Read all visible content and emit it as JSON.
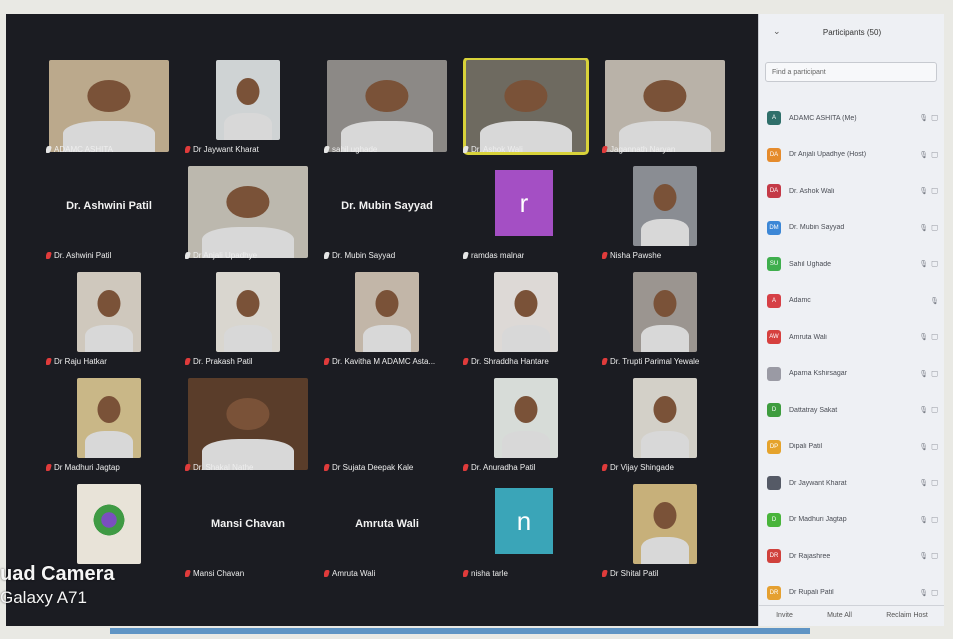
{
  "participants_panel": {
    "title": "Participants (50)",
    "search_placeholder": "Find a participant",
    "footer": [
      "Invite",
      "Mute All",
      "Reclaim Host"
    ],
    "rows": [
      {
        "initials": "A",
        "name": "ADAMC ASHITA (Me)",
        "color": "#2f6f6a",
        "status": "🎙 ◻"
      },
      {
        "initials": "DA",
        "name": "Dr Anjali Upadhye (Host)",
        "color": "#e58b2c",
        "status": "🎙 ◻"
      },
      {
        "initials": "DA",
        "name": "Dr. Ashok Wali",
        "color": "#c43a47",
        "status": "🎙 ◻"
      },
      {
        "initials": "DM",
        "name": "Dr. Mubin Sayyad",
        "color": "#3c87d6",
        "status": "🎙 ◻"
      },
      {
        "initials": "SU",
        "name": "Sahil Ughade",
        "color": "#3fae4d",
        "status": "🎙 ◻"
      },
      {
        "initials": "A",
        "name": "Adamc",
        "color": "#d64046",
        "status": "🎙"
      },
      {
        "initials": "AW",
        "name": "Amruta Wali",
        "color": "#d6403e",
        "status": "🎙 ◻"
      },
      {
        "initials": "",
        "name": "Aparna Kshirsagar",
        "color": "#9a9aa4",
        "status": "🎙 ◻"
      },
      {
        "initials": "D",
        "name": "Dattatray Sakat",
        "color": "#3e9c3e",
        "status": "🎙 ◻"
      },
      {
        "initials": "DP",
        "name": "Dipali Patil",
        "color": "#e5a32c",
        "status": "🎙 ◻"
      },
      {
        "initials": "",
        "name": "Dr Jaywant Kharat",
        "color": "#555a66",
        "status": "🎙 ◻"
      },
      {
        "initials": "D",
        "name": "Dr Madhuri Jagtap",
        "color": "#49b43b",
        "status": "🎙 ◻"
      },
      {
        "initials": "DR",
        "name": "Dr Rajashree",
        "color": "#d0413c",
        "status": "🎙 ◻"
      },
      {
        "initials": "DR",
        "name": "Dr Rupali Patil",
        "color": "#e5a030",
        "status": "🎙 ◻"
      }
    ]
  },
  "tiles": [
    {
      "label": "ADAMC ASHITA",
      "muted": false,
      "video": true,
      "bg": "#bba98c",
      "active": false
    },
    {
      "label": "Dr Jaywant Kharat",
      "muted": true,
      "video": true,
      "bg": "#cfd3d4",
      "active": false
    },
    {
      "label": "sahil ughade",
      "muted": false,
      "video": true,
      "bg": "#8c8986",
      "active": false
    },
    {
      "label": "Dr. Ashok Wali",
      "muted": false,
      "video": true,
      "bg": "#6e6a60",
      "active": true
    },
    {
      "label": "Jagannath Naryan",
      "muted": true,
      "video": true,
      "bg": "#b9b2a8",
      "active": false
    },
    {
      "label": "Dr. Ashwini Patil",
      "muted": true,
      "video": false,
      "big": "Dr. Ashwini Patil"
    },
    {
      "label": "Dr Anjali Upadhye",
      "muted": false,
      "video": true,
      "bg": "#bcb8ae",
      "active": false
    },
    {
      "label": "Dr. Mubin Sayyad",
      "muted": false,
      "video": false,
      "big": "Dr. Mubin Sayyad"
    },
    {
      "label": "ramdas malnar",
      "muted": false,
      "video": false,
      "letter": "r",
      "letter_bg": "#a44fc4"
    },
    {
      "label": "Nisha Pawshe",
      "muted": true,
      "video": true,
      "bg": "#8a8d93",
      "active": false
    },
    {
      "label": "Dr Raju Hatkar",
      "muted": true,
      "video": true,
      "bg": "#cfc8bd",
      "active": false
    },
    {
      "label": "Dr. Prakash Patil",
      "muted": true,
      "video": true,
      "bg": "#d9d6cf",
      "active": false
    },
    {
      "label": "Dr. Kavitha M ADAMC Asta...",
      "muted": true,
      "video": true,
      "bg": "#c2b6a8",
      "active": false
    },
    {
      "label": "Dr. Shraddha Hantare",
      "muted": true,
      "video": true,
      "bg": "#ddd9d6",
      "active": false
    },
    {
      "label": "Dr. Trupti Parimal Yewale",
      "muted": true,
      "video": true,
      "bg": "#9b9590",
      "active": false
    },
    {
      "label": "Dr Madhuri Jagtap",
      "muted": true,
      "video": true,
      "bg": "#c9b787",
      "active": false
    },
    {
      "label": "Dr. Shakal Nathe",
      "muted": true,
      "video": true,
      "bg": "#5a3d2a",
      "active": false
    },
    {
      "label": "Dr Sujata Deepak Kale",
      "muted": true,
      "video": false,
      "big": ""
    },
    {
      "label": "Dr. Anuradha Patil",
      "muted": true,
      "video": true,
      "bg": "#d7dcd8",
      "active": false
    },
    {
      "label": "Dr Vijay Shingade",
      "muted": true,
      "video": true,
      "bg": "#d3d0c8",
      "active": false
    },
    {
      "label": "",
      "muted": false,
      "video": true,
      "bg": "#e8e3d8",
      "active": false,
      "logo": true
    },
    {
      "label": "Mansi Chavan",
      "muted": true,
      "video": false,
      "big": "Mansi Chavan"
    },
    {
      "label": "Amruta Wali",
      "muted": true,
      "video": false,
      "big": "Amruta Wali"
    },
    {
      "label": "nisha tarle",
      "muted": true,
      "video": false,
      "letter": "n",
      "letter_bg": "#3aa5b8"
    },
    {
      "label": "Dr Shital Patil",
      "muted": true,
      "video": true,
      "bg": "#c7b07a",
      "active": false
    }
  ],
  "watermark": {
    "line1": "uad Camera",
    "line2": "Galaxy A71"
  }
}
